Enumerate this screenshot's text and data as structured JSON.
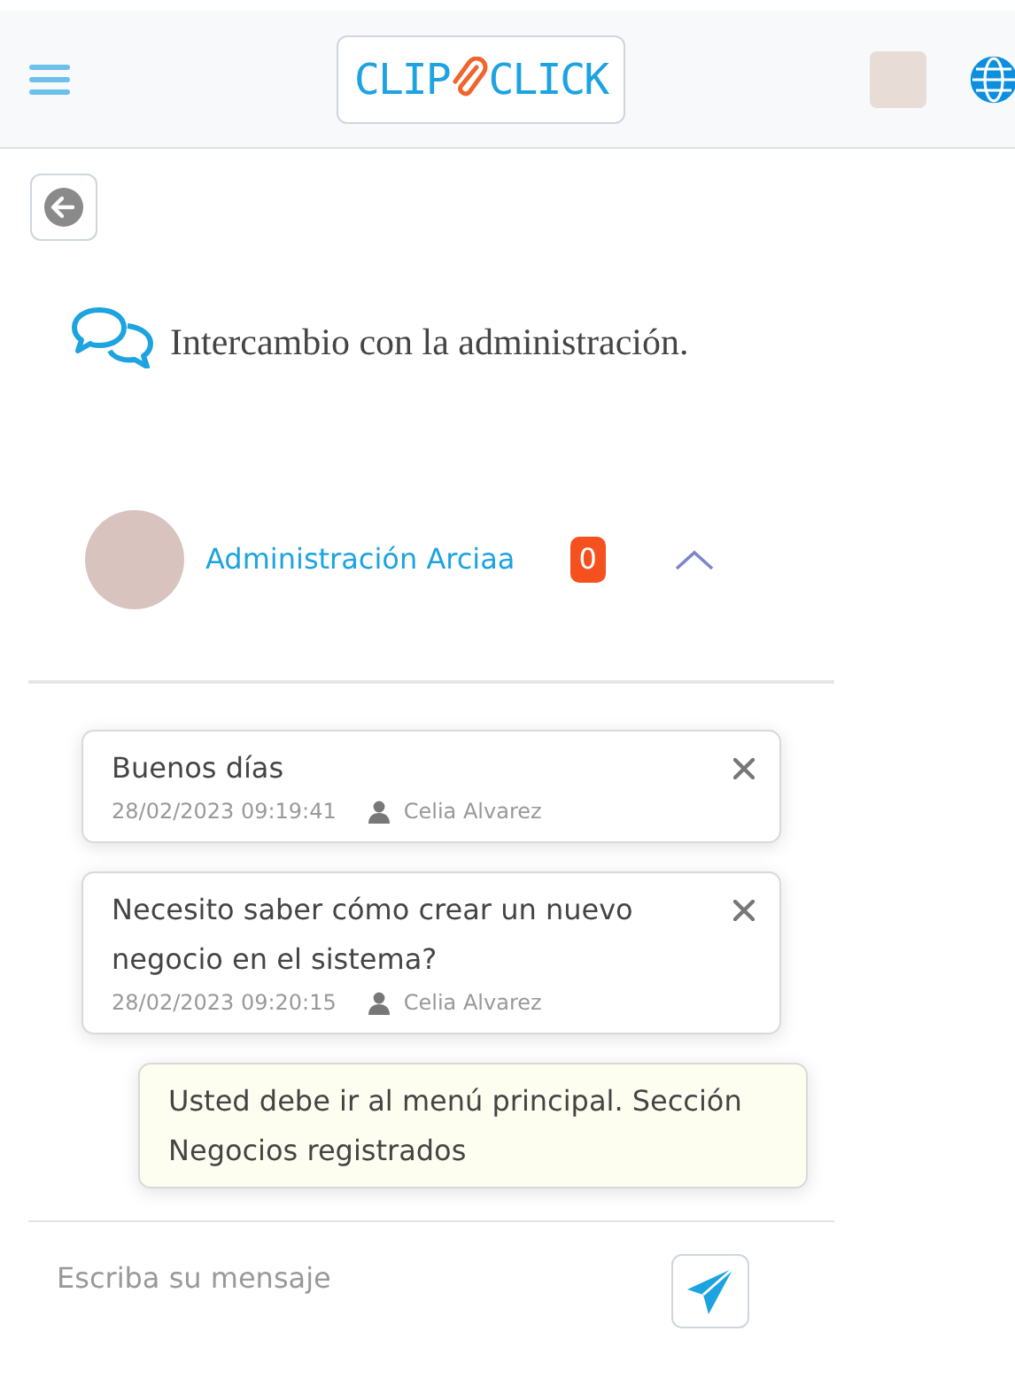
{
  "header": {
    "logo": {
      "left": "CLIP",
      "right": "CLICK"
    }
  },
  "page": {
    "title": "Intercambio con la administración."
  },
  "contact": {
    "name": "Administración Arciaa",
    "unread": "0",
    "expanded": true
  },
  "messages": [
    {
      "kind": "received",
      "text": "Buenos días",
      "date": "28/02/2023 09:19:41",
      "author": "Celia Alvarez",
      "deletable": true
    },
    {
      "kind": "received",
      "text": "Necesito saber cómo crear un nuevo negocio en el sistema?",
      "date": "28/02/2023 09:20:15",
      "author": "Celia Alvarez",
      "deletable": true
    },
    {
      "kind": "sent",
      "text": "Usted debe ir al menú principal. Sección Negocios registrados",
      "deletable": false
    }
  ],
  "composer": {
    "placeholder": "Escriba su mensaje"
  }
}
